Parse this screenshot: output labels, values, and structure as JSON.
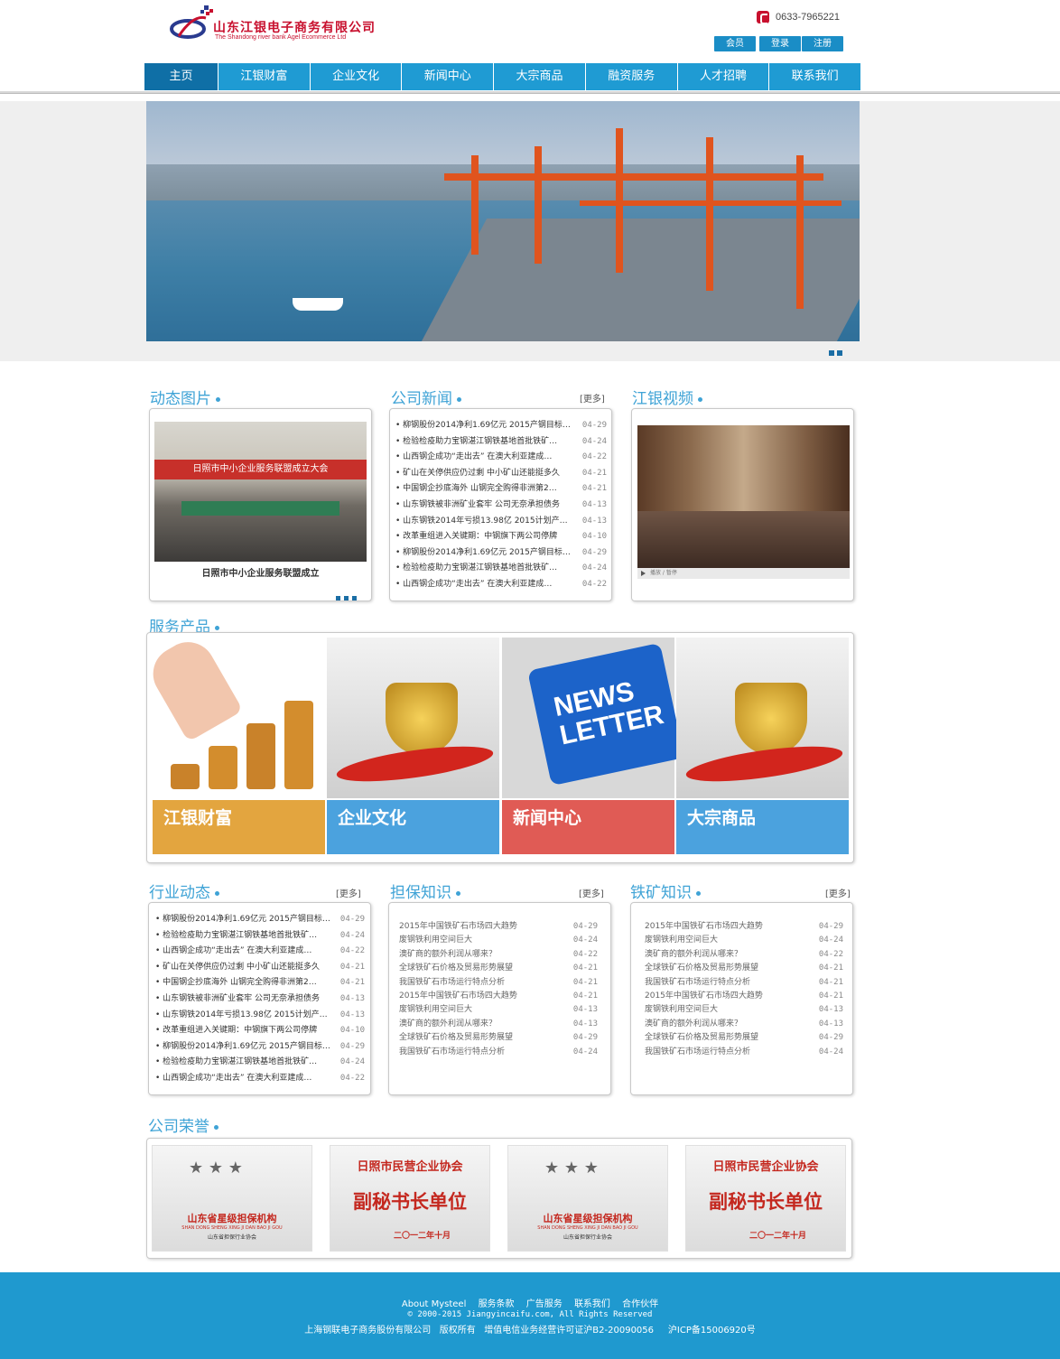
{
  "header": {
    "company_cn": "山东江银电子商务有限公司",
    "company_en": "The Shandong river bank Agel Ecommerce Ltd",
    "phone": "0633-7965221",
    "buttons": [
      "会员",
      "登录",
      "注册"
    ]
  },
  "nav": [
    "主页",
    "江银财富",
    "企业文化",
    "新闻中心",
    "大宗商品",
    "融资服务",
    "人才招聘",
    "联系我们"
  ],
  "sections": {
    "photos_title": "动态图片",
    "company_news_title": "公司新闻",
    "video_title": "江银视频",
    "products_title": "服务产品",
    "industry_title": "行业动态",
    "guarantee_title": "担保知识",
    "iron_title": "铁矿知识",
    "honor_title": "公司荣誉",
    "more": "[更多]"
  },
  "photo_caption": "日照市中小企业服务联盟成立",
  "photo_banner_text": "日照市中小企业服务联盟成立大会",
  "company_news": [
    {
      "t": "柳钢股份2014净利1.69亿元 2015产钢目标…",
      "d": "04-29"
    },
    {
      "t": "检验检疫助力宝钢湛江钢铁基地首批铁矿…",
      "d": "04-24"
    },
    {
      "t": "山西钢企成功“走出去” 在澳大利亚建成…",
      "d": "04-22"
    },
    {
      "t": "矿山在关停供应仍过剩 中小矿山还能挺多久",
      "d": "04-21"
    },
    {
      "t": "中国钢企抄底海外 山钢完全购得非洲第2…",
      "d": "04-21"
    },
    {
      "t": "山东钢铁被非洲矿业套牢 公司无奈承担债务",
      "d": "04-13"
    },
    {
      "t": "山东钢铁2014年亏损13.98亿 2015计划产…",
      "d": "04-13"
    },
    {
      "t": "改革重组进入关键期：中钢旗下两公司停牌",
      "d": "04-10"
    },
    {
      "t": "柳钢股份2014净利1.69亿元 2015产钢目标…",
      "d": "04-29"
    },
    {
      "t": "检验检疫助力宝钢湛江钢铁基地首批铁矿…",
      "d": "04-24"
    },
    {
      "t": "山西钢企成功“走出去” 在澳大利亚建成…",
      "d": "04-22"
    }
  ],
  "video_controls": "播放 / 暂停",
  "products": [
    {
      "label": "江银财富",
      "color": "#e3a53f"
    },
    {
      "label": "企业文化",
      "color": "#4ba2de"
    },
    {
      "label": "新闻中心",
      "color": "#e05b55"
    },
    {
      "label": "大宗商品",
      "color": "#4ba2de"
    }
  ],
  "newsletter_text": [
    "NEWS",
    "LETTER"
  ],
  "industry_news": [
    {
      "t": "柳钢股份2014净利1.69亿元 2015产钢目标…",
      "d": "04-29"
    },
    {
      "t": "检验检疫助力宝钢湛江钢铁基地首批铁矿…",
      "d": "04-24"
    },
    {
      "t": "山西钢企成功“走出去” 在澳大利亚建成…",
      "d": "04-22"
    },
    {
      "t": "矿山在关停供应仍过剩 中小矿山还能挺多久",
      "d": "04-21"
    },
    {
      "t": "中国钢企抄底海外 山钢完全购得非洲第2…",
      "d": "04-21"
    },
    {
      "t": "山东钢铁被非洲矿业套牢 公司无奈承担债务",
      "d": "04-13"
    },
    {
      "t": "山东钢铁2014年亏损13.98亿 2015计划产…",
      "d": "04-13"
    },
    {
      "t": "改革重组进入关键期：中钢旗下两公司停牌",
      "d": "04-10"
    },
    {
      "t": "柳钢股份2014净利1.69亿元 2015产钢目标…",
      "d": "04-29"
    },
    {
      "t": "检验检疫助力宝钢湛江钢铁基地首批铁矿…",
      "d": "04-24"
    },
    {
      "t": "山西钢企成功“走出去” 在澳大利亚建成…",
      "d": "04-22"
    }
  ],
  "guarantee_list": [
    {
      "t": "2015年中国铁矿石市场四大趋势",
      "d": "04-29"
    },
    {
      "t": "废钢铁利用空间巨大",
      "d": "04-24"
    },
    {
      "t": "澳矿商的额外利润从哪来？",
      "d": "04-22"
    },
    {
      "t": "全球铁矿石价格及贸易形势展望",
      "d": "04-21"
    },
    {
      "t": "我国铁矿石市场运行特点分析",
      "d": "04-21"
    },
    {
      "t": "2015年中国铁矿石市场四大趋势",
      "d": "04-21"
    },
    {
      "t": "废钢铁利用空间巨大",
      "d": "04-13"
    },
    {
      "t": "澳矿商的额外利润从哪来？",
      "d": "04-13"
    },
    {
      "t": "全球铁矿石价格及贸易形势展望",
      "d": "04-29"
    },
    {
      "t": "我国铁矿石市场运行特点分析",
      "d": "04-24"
    }
  ],
  "iron_list": [
    {
      "t": "2015年中国铁矿石市场四大趋势",
      "d": "04-29"
    },
    {
      "t": "废钢铁利用空间巨大",
      "d": "04-24"
    },
    {
      "t": "澳矿商的额外利润从哪来？",
      "d": "04-22"
    },
    {
      "t": "全球铁矿石价格及贸易形势展望",
      "d": "04-21"
    },
    {
      "t": "我国铁矿石市场运行特点分析",
      "d": "04-21"
    },
    {
      "t": "2015年中国铁矿石市场四大趋势",
      "d": "04-21"
    },
    {
      "t": "废钢铁利用空间巨大",
      "d": "04-13"
    },
    {
      "t": "澳矿商的额外利润从哪来？",
      "d": "04-13"
    },
    {
      "t": "全球铁矿石价格及贸易形势展望",
      "d": "04-29"
    },
    {
      "t": "我国铁矿石市场运行特点分析",
      "d": "04-24"
    }
  ],
  "honors": {
    "plaque_a_title": "山东省星级担保机构",
    "plaque_a_en": "SHAN DONG SHENG XING JI DAN BAO JI GOU",
    "plaque_a_issuer": "山东省担保行业协会",
    "plaque_b_org": "日照市民营企业协会",
    "plaque_b_title": "副秘书长单位",
    "plaque_b_date": "二〇一二年十月"
  },
  "footer": {
    "links": [
      "About Mysteel",
      "服务条款",
      "广告服务",
      "联系我们",
      "合作伙伴"
    ],
    "copyright": "© 2000-2015 Jiangyincaifu.com, All Rights Reserved",
    "license": "上海钢联电子商务股份有限公司   版权所有   增值电信业务经营许可证沪B2-20090056     沪ICP备15006920号"
  },
  "colors": {
    "nav": "#1f9bd3",
    "nav_active": "#0f6fa6",
    "accent": "#3fa3d6",
    "footer": "#1f99cf"
  }
}
